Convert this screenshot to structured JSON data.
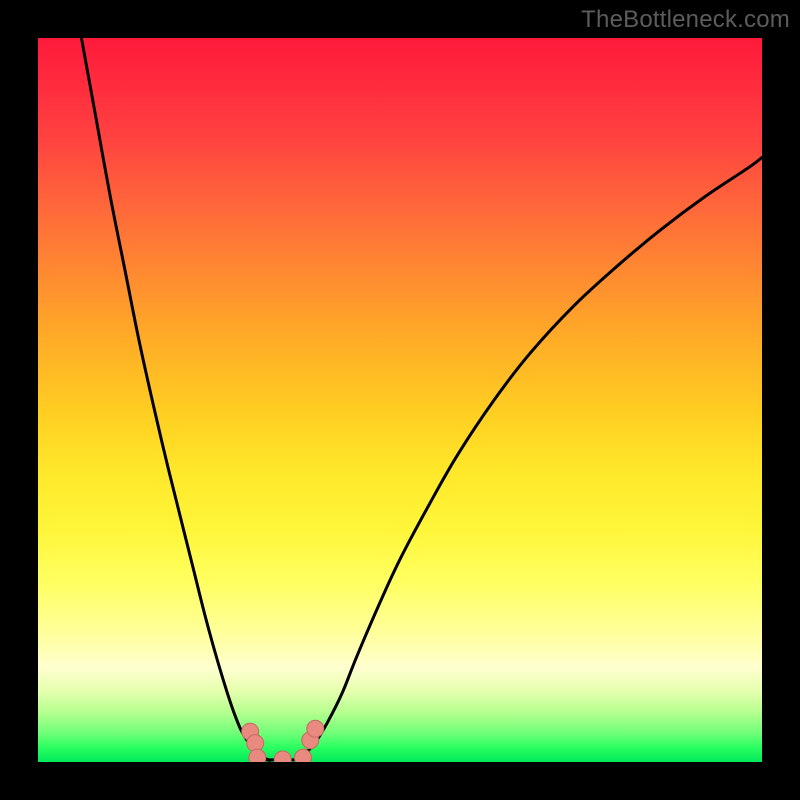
{
  "watermark": {
    "text": "TheBottleneck.com"
  },
  "palette": {
    "background": "#000000",
    "curve_stroke": "#000000",
    "dot_fill": "#e88a80",
    "dot_stroke": "#c86860",
    "gradient_top": "#ff1a3a",
    "gradient_bottom": "#00e85a"
  },
  "chart_data": {
    "type": "line",
    "title": "",
    "xlabel": "",
    "ylabel": "",
    "xlim": [
      0,
      100
    ],
    "ylim": [
      0,
      100
    ],
    "grid": false,
    "legend": false,
    "series": [
      {
        "name": "left-curve",
        "x": [
          6,
          8,
          10,
          12,
          14,
          16,
          18,
          20,
          21.5,
          23,
          24.5,
          26,
          27,
          28,
          29,
          30,
          31,
          32
        ],
        "y": [
          100,
          89,
          78,
          68,
          58,
          49,
          40.5,
          32.5,
          26.5,
          20.5,
          15,
          10,
          7,
          4.5,
          2.8,
          1.5,
          0.7,
          0.2
        ]
      },
      {
        "name": "right-curve",
        "x": [
          36,
          37,
          38.5,
          40,
          42,
          44,
          47,
          50,
          54,
          58,
          63,
          68,
          74,
          80,
          86,
          92,
          98,
          100
        ],
        "y": [
          0.2,
          1.2,
          3,
          5.5,
          9.5,
          14.5,
          21.5,
          28,
          35.5,
          42.5,
          50,
          56.5,
          63,
          68.5,
          73.5,
          78,
          82,
          83.5
        ]
      },
      {
        "name": "baseline",
        "x": [
          29.5,
          37.5
        ],
        "y": [
          0.3,
          0.3
        ]
      }
    ],
    "dots": [
      {
        "name": "left-top",
        "x": 29.3,
        "y": 4.2
      },
      {
        "name": "left-mid",
        "x": 30.0,
        "y": 2.6
      },
      {
        "name": "left-low",
        "x": 30.3,
        "y": 0.6
      },
      {
        "name": "mid-low",
        "x": 33.8,
        "y": 0.35
      },
      {
        "name": "right-low",
        "x": 36.6,
        "y": 0.6
      },
      {
        "name": "right-top",
        "x": 37.6,
        "y": 3.0
      },
      {
        "name": "right-extra",
        "x": 38.3,
        "y": 4.6
      }
    ]
  }
}
